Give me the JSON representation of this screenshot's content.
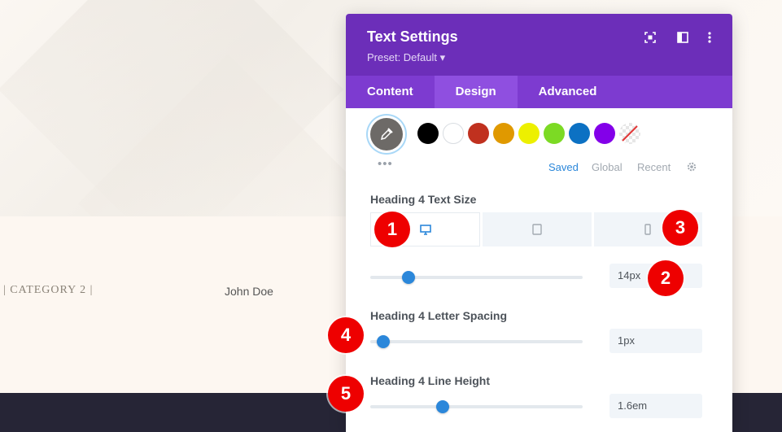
{
  "background": {
    "category_text": "| CATEGORY 2 |",
    "author_text": "John Doe"
  },
  "panel": {
    "title": "Text Settings",
    "preset": "Preset: Default ▾",
    "header_icons": [
      "focus-icon",
      "split-view-icon",
      "more-vertical-icon"
    ],
    "tabs": [
      {
        "label": "Content"
      },
      {
        "label": "Design"
      },
      {
        "label": "Advanced"
      }
    ],
    "active_tab": "Design",
    "colors": {
      "header_bg": "#6c2eb9",
      "tabs_bg": "#7d3bd0",
      "active_tab_bg": "#8f4fe0",
      "accent_blue": "#2b87da"
    },
    "swatches": [
      "#000000",
      "#ffffff",
      "#c0311f",
      "#e09900",
      "#edf000",
      "#7cda24",
      "#0c71c3",
      "#8300e9"
    ],
    "more_dots": "•••",
    "palette_tabs": {
      "saved": "Saved",
      "global": "Global",
      "recent": "Recent"
    },
    "settings": {
      "size": {
        "label": "Heading 4 Text Size",
        "value": "14px",
        "slider_fraction": 0.15
      },
      "letter_spacing": {
        "label": "Heading 4 Letter Spacing",
        "value": "1px",
        "slider_fraction": 0.03
      },
      "line_height": {
        "label": "Heading 4 Line Height",
        "value": "1.6em",
        "slider_fraction": 0.31
      }
    },
    "devices": [
      "desktop-icon",
      "tablet-icon",
      "phone-icon"
    ],
    "active_device": "desktop-icon"
  },
  "annotations": [
    "1",
    "2",
    "3",
    "4",
    "5"
  ]
}
